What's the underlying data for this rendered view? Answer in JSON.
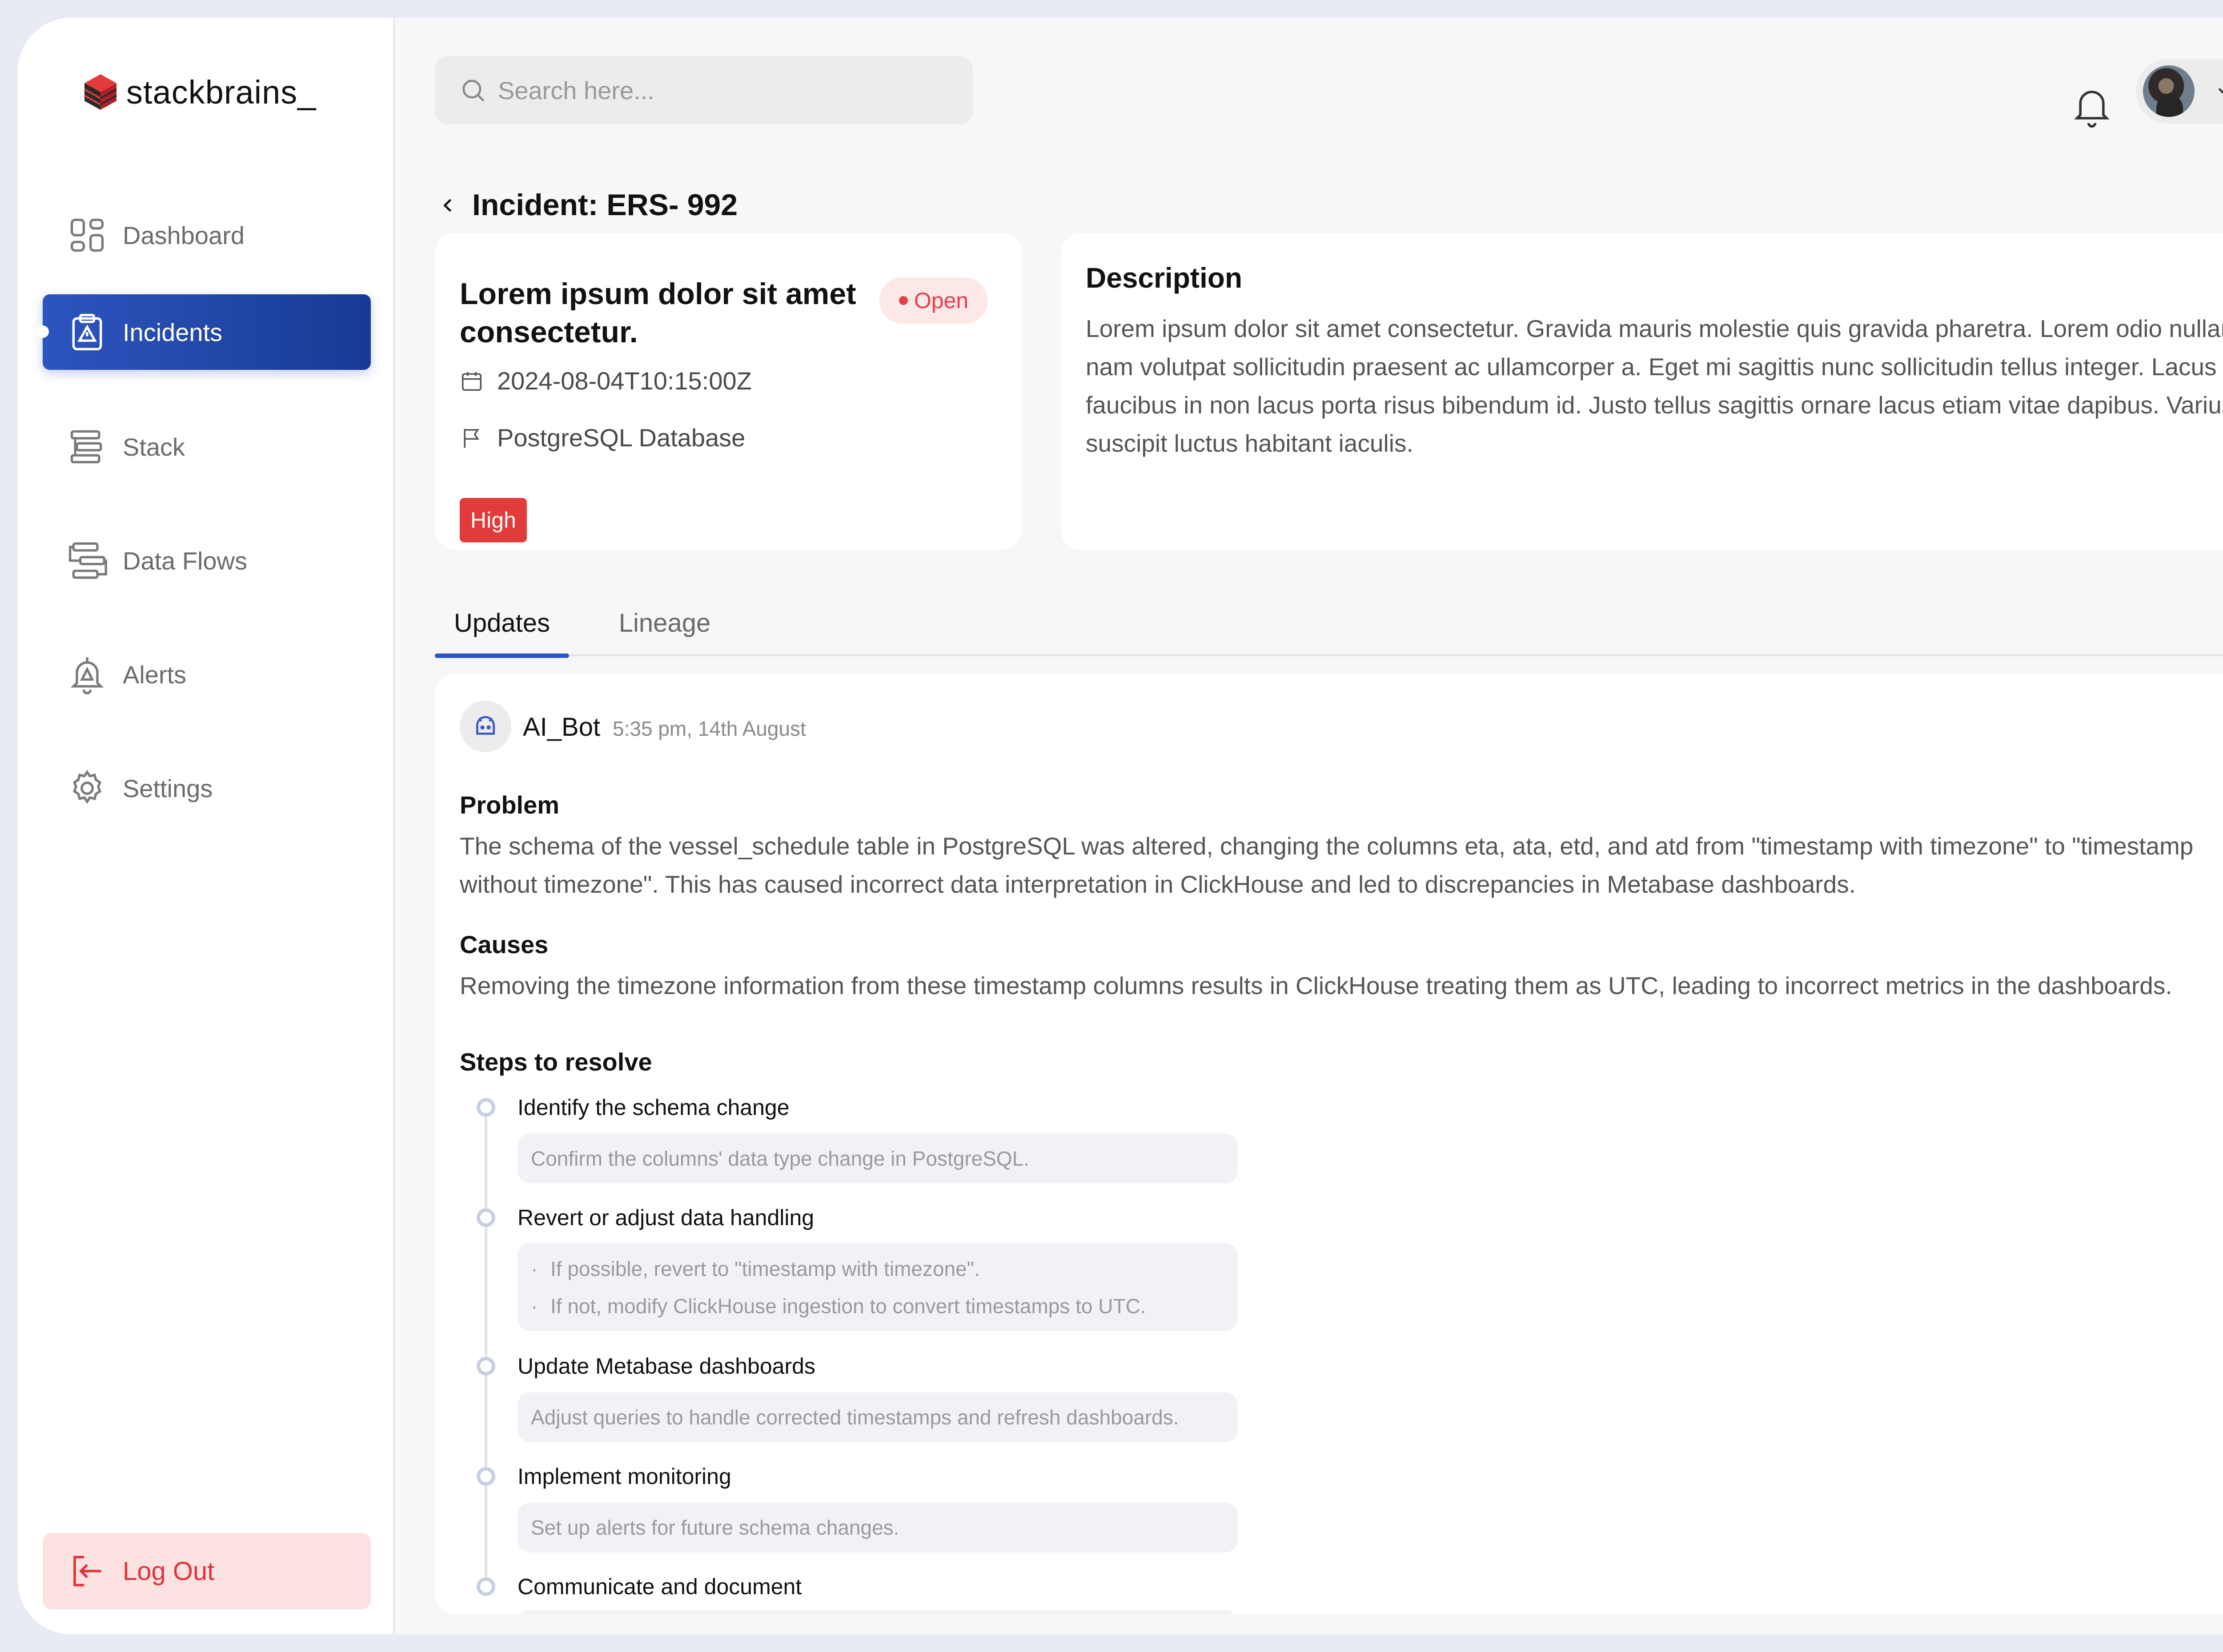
{
  "brand": {
    "name": "stackbrains_"
  },
  "sidebar": {
    "items": [
      {
        "label": "Dashboard",
        "icon": "dashboard-icon",
        "active": false
      },
      {
        "label": "Incidents",
        "icon": "incident-icon",
        "active": true
      },
      {
        "label": "Stack",
        "icon": "stack-icon",
        "active": false
      },
      {
        "label": "Data Flows",
        "icon": "data-flows-icon",
        "active": false
      },
      {
        "label": "Alerts",
        "icon": "bell-alert-icon",
        "active": false
      },
      {
        "label": "Settings",
        "icon": "gear-icon",
        "active": false
      }
    ],
    "logout_label": "Log Out"
  },
  "search": {
    "placeholder": "Search here..."
  },
  "page": {
    "title": "Incident: ERS- 992"
  },
  "incident": {
    "title": "Lorem ipsum dolor sit amet consectetur.",
    "status": "Open",
    "timestamp": "2024-08-04T10:15:00Z",
    "source": "PostgreSQL Database",
    "severity": "High"
  },
  "description": {
    "heading": "Description",
    "text": "Lorem ipsum dolor sit amet consectetur. Gravida mauris molestie quis gravida pharetra. Lorem odio nullam nam volutpat sollicitudin praesent ac ullamcorper a. Eget mi sagittis nunc sollicitudin tellus integer. Lacus faucibus in non lacus porta risus bibendum id. Justo tellus sagittis ornare lacus etiam vitae dapibus. Varius suscipit luctus habitant iaculis."
  },
  "tabs": [
    {
      "label": "Updates",
      "active": true
    },
    {
      "label": "Lineage",
      "active": false
    }
  ],
  "update": {
    "author": "AI_Bot",
    "time": "5:35 pm, 14th August",
    "problem_heading": "Problem",
    "problem_text": "The schema of the vessel_schedule table in PostgreSQL was altered, changing the columns eta, ata, etd, and atd from \"timestamp with timezone\" to \"timestamp without timezone\". This has caused incorrect data interpretation in ClickHouse and led to discrepancies in Metabase dashboards.",
    "causes_heading": "Causes",
    "causes_text": "Removing the timezone information from these timestamp columns results in ClickHouse treating them as UTC, leading to incorrect metrics in the dashboards.",
    "steps_heading": "Steps to resolve",
    "steps": [
      {
        "title": "Identify the schema change",
        "details": [
          "Confirm the columns' data type change in PostgreSQL."
        ]
      },
      {
        "title": "Revert or adjust data handling",
        "details": [
          "If possible, revert to \"timestamp with timezone\".",
          "If not, modify ClickHouse ingestion to convert timestamps to UTC."
        ]
      },
      {
        "title": "Update Metabase dashboards",
        "details": [
          "Adjust queries to handle corrected timestamps and refresh dashboards."
        ]
      },
      {
        "title": "Implement monitoring",
        "details": [
          "Set up alerts for future schema changes."
        ]
      },
      {
        "title": "Communicate and document",
        "details": []
      }
    ]
  },
  "colors": {
    "accent": "#2b55c4",
    "danger": "#e23b3b",
    "status_open_bg": "#fde8e8",
    "logout_bg": "#fde2e2"
  }
}
